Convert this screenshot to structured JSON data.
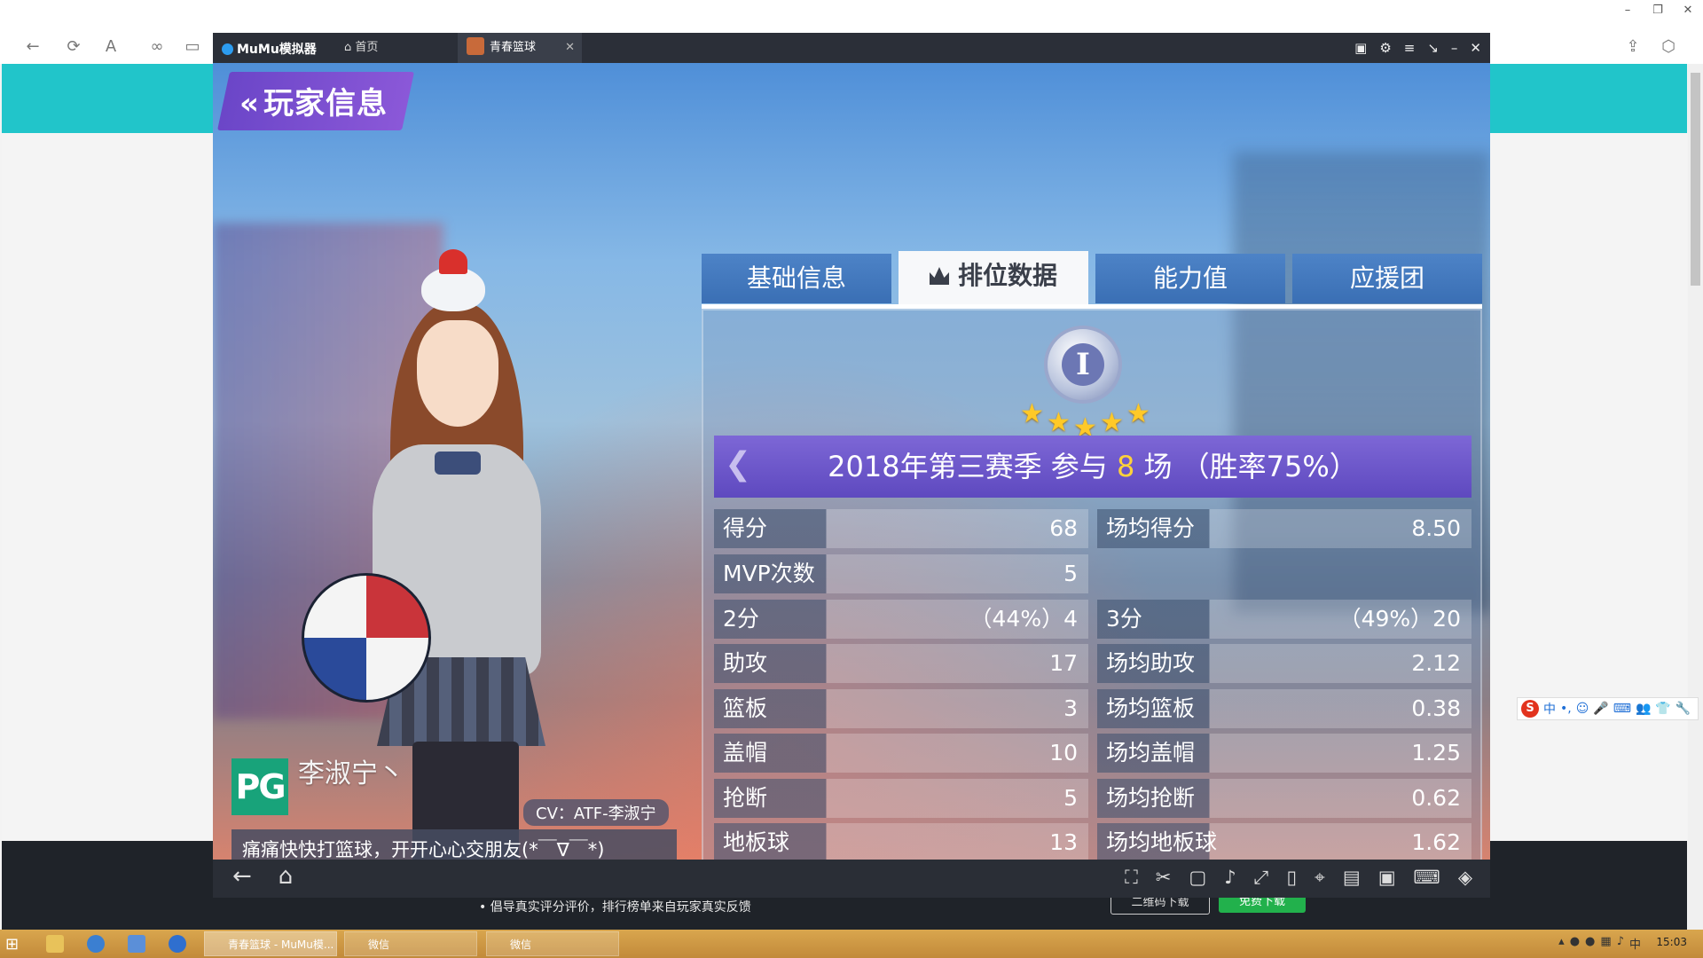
{
  "browser": {
    "window_controls": [
      "–",
      "❐",
      "✕"
    ],
    "nav_icons": [
      "arrow-left-icon",
      "refresh-icon",
      "text-size-icon",
      "link-icon",
      "layout-icon"
    ]
  },
  "emulator": {
    "app_name": "MuMu模拟器",
    "home_tab": "首页",
    "game_tab": "青春篮球",
    "tab_close": "✕",
    "controls": [
      "▣",
      "⚙",
      "≡",
      "↘",
      "–",
      "✕"
    ]
  },
  "game": {
    "page_title": "玩家信息",
    "tabs": [
      "基础信息",
      "排位数据",
      "能力值",
      "应援团"
    ],
    "active_tab": 1,
    "rank_numeral": "I",
    "rank_stars": 5,
    "season": {
      "prefix": "2018年第三赛季  参与 ",
      "games": "8",
      "suffix": " 场 （胜率75%）"
    },
    "stats_left": [
      {
        "label": "得分",
        "value": "68"
      },
      {
        "label": "MVP次数",
        "value": "5"
      },
      {
        "label": "2分",
        "value": "（44%）4"
      },
      {
        "label": "助攻",
        "value": "17"
      },
      {
        "label": "篮板",
        "value": "3"
      },
      {
        "label": "盖帽",
        "value": "10"
      },
      {
        "label": "抢断",
        "value": "5"
      },
      {
        "label": "地板球",
        "value": "13"
      }
    ],
    "stats_right": [
      {
        "label": "场均得分",
        "value": "8.50"
      },
      {
        "label": "3分",
        "value": "（49%）20"
      },
      {
        "label": "场均助攻",
        "value": "2.12"
      },
      {
        "label": "场均篮板",
        "value": "0.38"
      },
      {
        "label": "场均盖帽",
        "value": "1.25"
      },
      {
        "label": "场均抢断",
        "value": "0.62"
      },
      {
        "label": "场均地板球",
        "value": "1.62"
      }
    ],
    "position": "PG",
    "player_name": "李淑宁丶",
    "cv": "CV：ATF-李淑宁",
    "motto": "痛痛快快打篮球，开开心心交朋友(*￣∇￣*)"
  },
  "page_behind": {
    "notice": "倡导真实评分评价，排行榜单来自玩家真实反馈",
    "btn1": "二维码下载",
    "btn2": "免费下载"
  },
  "ime": {
    "logo": "S",
    "items": [
      "中",
      "•,",
      "☺",
      "🎤",
      "⌨",
      "👥",
      "👕",
      "🔧"
    ]
  },
  "taskbar": {
    "tasks": [
      "青春篮球 - MuMu模...",
      "微信",
      "微信"
    ],
    "tray_lang": "中",
    "clock": "15:03"
  },
  "colors": {
    "teal": "#21c5ca",
    "tab_blue": "#3a6fb4",
    "season_purple": "#6b55c8",
    "pg_green": "#18a37a",
    "gold": "#ffd23a"
  }
}
